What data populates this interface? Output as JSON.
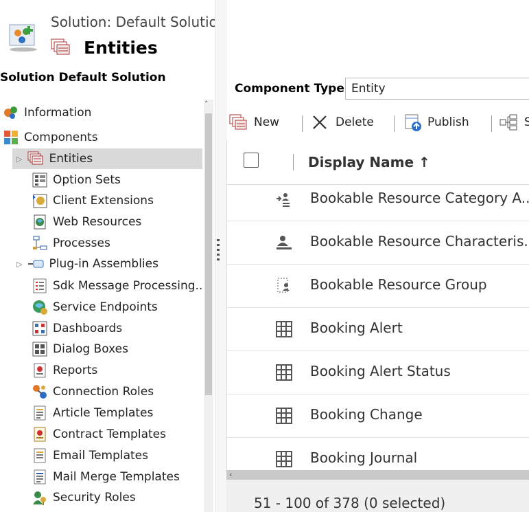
{
  "header": {
    "subtitle": "Solution: Default Solution",
    "title": "Entities",
    "solution_icon": "solution-puzzle-icon",
    "entity_icon": "entities-icon"
  },
  "left_nav": {
    "title": "Solution Default Solution",
    "items": [
      {
        "label": "Information",
        "icon": "information-icon"
      },
      {
        "label": "Components",
        "icon": "components-icon"
      },
      {
        "label": "Entities",
        "icon": "entities-icon",
        "selected": true
      },
      {
        "label": "Option Sets",
        "icon": "option-sets-icon"
      },
      {
        "label": "Client Extensions",
        "icon": "client-extensions-icon"
      },
      {
        "label": "Web Resources",
        "icon": "web-resources-icon"
      },
      {
        "label": "Processes",
        "icon": "processes-icon"
      },
      {
        "label": "Plug-in Assemblies",
        "icon": "plugin-assemblies-icon"
      },
      {
        "label": "Sdk Message Processing...",
        "icon": "sdk-message-icon"
      },
      {
        "label": "Service Endpoints",
        "icon": "service-endpoints-icon"
      },
      {
        "label": "Dashboards",
        "icon": "dashboards-icon"
      },
      {
        "label": "Dialog Boxes",
        "icon": "dialog-boxes-icon"
      },
      {
        "label": "Reports",
        "icon": "reports-icon"
      },
      {
        "label": "Connection Roles",
        "icon": "connection-roles-icon"
      },
      {
        "label": "Article Templates",
        "icon": "article-templates-icon"
      },
      {
        "label": "Contract Templates",
        "icon": "contract-templates-icon"
      },
      {
        "label": "Email Templates",
        "icon": "email-templates-icon"
      },
      {
        "label": "Mail Merge Templates",
        "icon": "mail-merge-templates-icon"
      },
      {
        "label": "Security Roles",
        "icon": "security-roles-icon"
      }
    ]
  },
  "component_type": {
    "label": "Component Type",
    "value": "Entity"
  },
  "toolbar": {
    "new_label": "New",
    "delete_label": "Delete",
    "publish_label": "Publish",
    "more_label": "S"
  },
  "grid": {
    "column_header": "Display Name ↑",
    "rows": [
      {
        "name": "Bookable Resource Category A...",
        "icon": "resource-category-icon"
      },
      {
        "name": "Bookable Resource Characteris...",
        "icon": "resource-characteristic-icon"
      },
      {
        "name": "Bookable Resource Group",
        "icon": "resource-group-icon"
      },
      {
        "name": "Booking Alert",
        "icon": "grid-entity-icon"
      },
      {
        "name": "Booking Alert Status",
        "icon": "grid-entity-icon"
      },
      {
        "name": "Booking Change",
        "icon": "grid-entity-icon"
      },
      {
        "name": "Booking Journal",
        "icon": "grid-entity-icon"
      }
    ]
  },
  "footer": {
    "status": "51 - 100 of 378 (0 selected)"
  }
}
